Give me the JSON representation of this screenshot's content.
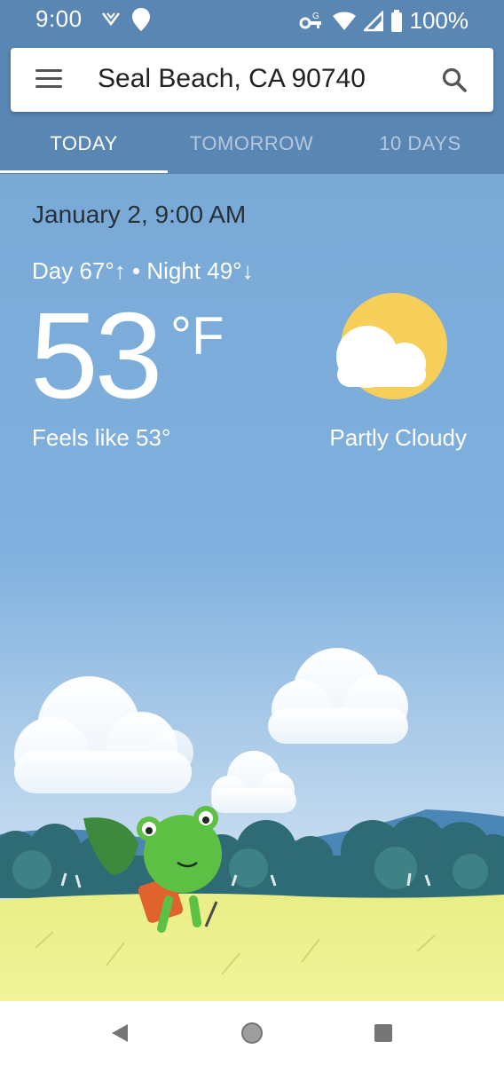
{
  "status_bar": {
    "time": "9:00",
    "battery": "100%",
    "icons": [
      "signal-icon",
      "location-icon",
      "vpn-key-icon",
      "wifi-icon",
      "cell-signal-icon",
      "battery-icon"
    ]
  },
  "search": {
    "location": "Seal Beach, CA 90740",
    "menu_icon": "menu-icon",
    "search_icon": "search-icon"
  },
  "tabs": [
    {
      "label": "TODAY",
      "active": true
    },
    {
      "label": "TOMORROW",
      "active": false
    },
    {
      "label": "10 DAYS",
      "active": false
    }
  ],
  "weather": {
    "datetime": "January 2, 9:00 AM",
    "day_night": "Day 67°↑ • Night 49°↓",
    "temperature": "53",
    "unit": "°F",
    "feels_like": "Feels like 53°",
    "condition": "Partly Cloudy",
    "icon": "partly-cloudy-icon"
  },
  "nav": {
    "back": "back-icon",
    "home": "home-icon",
    "recents": "recents-icon"
  },
  "colors": {
    "header": "#5a86b3",
    "sky": "#7aa9d6",
    "sun": "#f5cf5a",
    "grass": "#eef08a"
  }
}
